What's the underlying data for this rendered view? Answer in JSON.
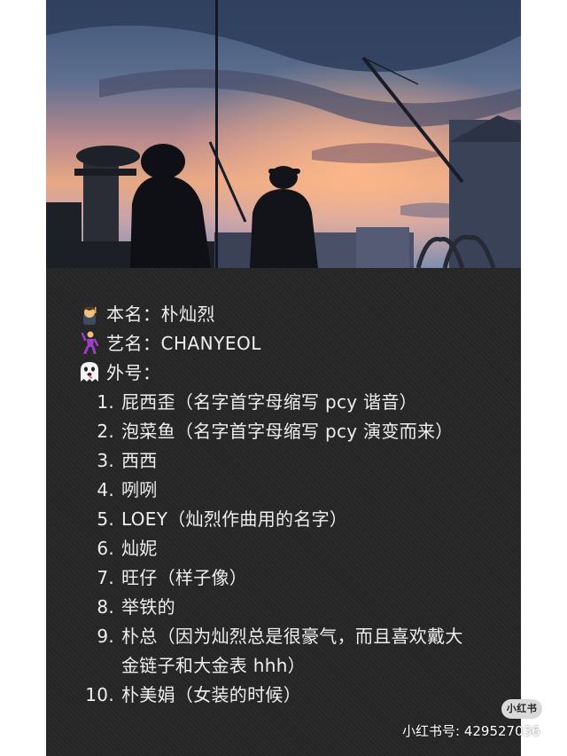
{
  "profile": {
    "real_name_label": "本名：朴灿烈",
    "stage_name_label": "艺名：CHANYEOL",
    "nickname_label": "外号："
  },
  "nicknames": [
    {
      "num": "1.",
      "text": "屁西歪（名字首字母缩写 pcy 谐音）"
    },
    {
      "num": "2.",
      "text": "泡菜鱼（名字首字母缩写 pcy 演变而来）"
    },
    {
      "num": "3.",
      "text": "西西"
    },
    {
      "num": "4.",
      "text": "咧咧"
    },
    {
      "num": "5.",
      "text": "LOEY（灿烈作曲用的名字）"
    },
    {
      "num": "6.",
      "text": "灿妮"
    },
    {
      "num": "7.",
      "text": "旺仔（样子像）"
    },
    {
      "num": "8.",
      "text": "举铁的"
    },
    {
      "num": "9.",
      "text": "朴总（因为灿烈总是很豪气，而且喜欢戴大金链子和大金表 hhh）"
    },
    {
      "num": "10.",
      "text": "朴美娟（女装的时候）"
    }
  ],
  "watermark": {
    "badge": "小红书",
    "id_text": "小红书号: 429527036"
  },
  "icons": {
    "real_name": "student-emoji-icon",
    "stage_name": "dancing-person-emoji-icon",
    "nickname": "ghost-emoji-icon"
  }
}
